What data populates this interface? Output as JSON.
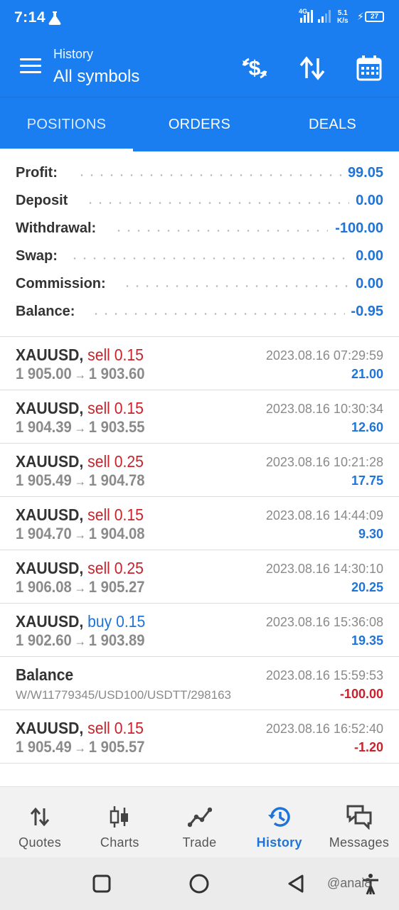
{
  "status_bar": {
    "time": "7:14",
    "network": "4G",
    "speed_value": "5.1",
    "speed_unit": "K/s",
    "battery": "27"
  },
  "app_bar": {
    "subtitle": "History",
    "title": "All symbols",
    "icons": [
      "menu-icon",
      "currency-exchange-icon",
      "sort-icon",
      "calendar-icon"
    ]
  },
  "tabs": [
    {
      "label": "POSITIONS",
      "active": true
    },
    {
      "label": "ORDERS",
      "active": false
    },
    {
      "label": "DEALS",
      "active": false
    }
  ],
  "summary": [
    {
      "label": "Profit:",
      "value": "99.05"
    },
    {
      "label": "Deposit",
      "value": "0.00"
    },
    {
      "label": "Withdrawal:",
      "value": "-100.00"
    },
    {
      "label": "Swap:",
      "value": "0.00"
    },
    {
      "label": "Commission:",
      "value": "0.00"
    },
    {
      "label": "Balance:",
      "value": "-0.95"
    }
  ],
  "deals": [
    {
      "symbol": "XAUUSD,",
      "side": "sell 0.15",
      "side_type": "sell",
      "open": "1 905.00",
      "close": "1 903.60",
      "datetime": "2023.08.16 07:29:59",
      "profit": "21.00",
      "profit_sign": "pos"
    },
    {
      "symbol": "XAUUSD,",
      "side": "sell 0.15",
      "side_type": "sell",
      "open": "1 904.39",
      "close": "1 903.55",
      "datetime": "2023.08.16 10:30:34",
      "profit": "12.60",
      "profit_sign": "pos"
    },
    {
      "symbol": "XAUUSD,",
      "side": "sell 0.25",
      "side_type": "sell",
      "open": "1 905.49",
      "close": "1 904.78",
      "datetime": "2023.08.16 10:21:28",
      "profit": "17.75",
      "profit_sign": "pos"
    },
    {
      "symbol": "XAUUSD,",
      "side": "sell 0.15",
      "side_type": "sell",
      "open": "1 904.70",
      "close": "1 904.08",
      "datetime": "2023.08.16 14:44:09",
      "profit": "9.30",
      "profit_sign": "pos"
    },
    {
      "symbol": "XAUUSD,",
      "side": "sell 0.25",
      "side_type": "sell",
      "open": "1 906.08",
      "close": "1 905.27",
      "datetime": "2023.08.16 14:30:10",
      "profit": "20.25",
      "profit_sign": "pos"
    },
    {
      "symbol": "XAUUSD,",
      "side": "buy 0.15",
      "side_type": "buy",
      "open": "1 902.60",
      "close": "1 903.89",
      "datetime": "2023.08.16 15:36:08",
      "profit": "19.35",
      "profit_sign": "pos"
    },
    {
      "symbol": "Balance",
      "side": "",
      "side_type": "",
      "comment": "W/W11779345/USD100/USDTT/298163",
      "datetime": "2023.08.16 15:59:53",
      "profit": "-100.00",
      "profit_sign": "neg"
    },
    {
      "symbol": "XAUUSD,",
      "side": "sell 0.15",
      "side_type": "sell",
      "open": "1 905.49",
      "close": "1 905.57",
      "datetime": "2023.08.16 16:52:40",
      "profit": "-1.20",
      "profit_sign": "neg"
    }
  ],
  "price_arrow": "→",
  "bottom_nav": [
    {
      "label": "Quotes",
      "icon": "quotes-icon",
      "active": false
    },
    {
      "label": "Charts",
      "icon": "charts-icon",
      "active": false
    },
    {
      "label": "Trade",
      "icon": "trade-icon",
      "active": false
    },
    {
      "label": "History",
      "icon": "history-icon",
      "active": true
    },
    {
      "label": "Messages",
      "icon": "messages-icon",
      "active": false
    }
  ],
  "watermark": "@anai8",
  "colors": {
    "primary": "#1a7ef0",
    "value_blue": "#1f74d6",
    "sell_red": "#c8222b",
    "muted_gray": "#8a8a8a"
  }
}
